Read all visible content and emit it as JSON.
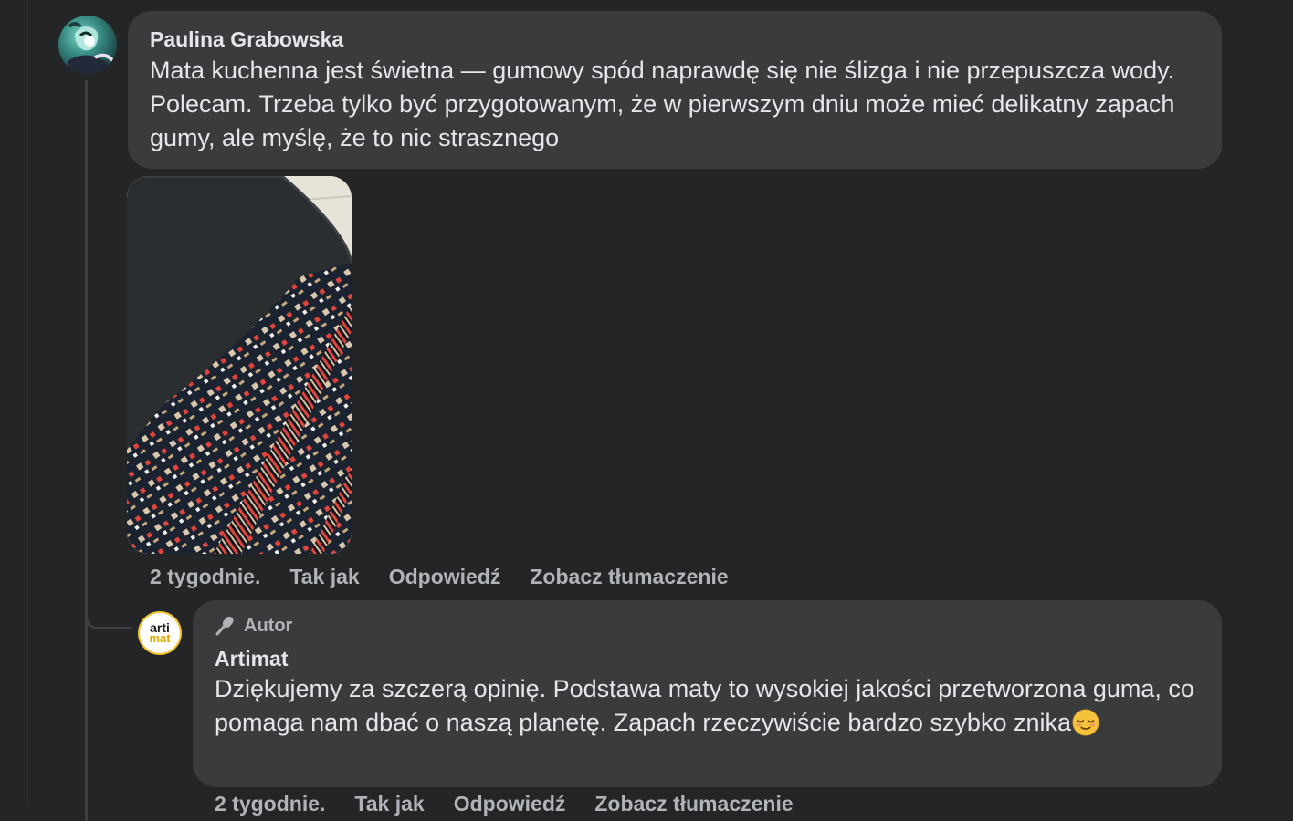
{
  "comment": {
    "author": "Paulina Grabowska",
    "text": "Mata kuchenna jest świetna — gumowy spód naprawdę się nie ślizga i nie przepuszcza wody. Polecam. Trzeba tylko być przygotowanym, że w pierwszym dniu może mieć delikatny zapach gumy, ale myślę, że to nic strasznego",
    "time": "2 tygodnie.",
    "like_label": "Tak jak",
    "reply_label": "Odpowiedź",
    "translate_label": "Zobacz tłumaczenie"
  },
  "reply": {
    "badge": "Autor",
    "author": "Artimat",
    "avatar_line1": "arti",
    "avatar_line2": "mat",
    "text": "Dziękujemy za szczerą opinię. Podstawa maty to wysokiej jakości przetworzona guma, co pomaga nam dbać o naszą planetę. Zapach rzeczywiście bardzo szybko znika",
    "emoji": "relieved-face-icon",
    "time": "2 tygodnie.",
    "like_label": "Tak jak",
    "reply_label": "Odpowiedź",
    "translate_label": "Zobacz tłumaczenie"
  },
  "colors": {
    "background": "#242526",
    "bubble": "#3a3b3c",
    "text": "#e4e6eb",
    "secondary_text": "#b0b3b8",
    "logo_accent": "#f2c230"
  }
}
